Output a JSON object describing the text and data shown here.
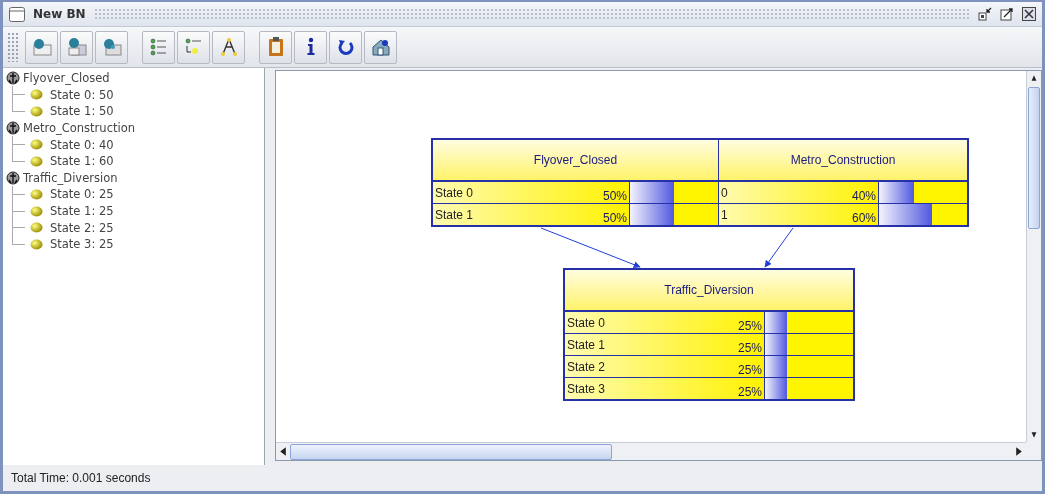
{
  "window": {
    "title": "New BN"
  },
  "tree": [
    {
      "name": "Flyover_Closed",
      "children": [
        {
          "label": "State 0: 50"
        },
        {
          "label": "State 1: 50"
        }
      ]
    },
    {
      "name": "Metro_Construction",
      "children": [
        {
          "label": "State 0: 40"
        },
        {
          "label": "State 1: 60"
        }
      ]
    },
    {
      "name": "Traffic_Diversion",
      "children": [
        {
          "label": "State 0: 25"
        },
        {
          "label": "State 1: 25"
        },
        {
          "label": "State 2: 25"
        },
        {
          "label": "State 3: 25"
        }
      ]
    }
  ],
  "boxes": [
    {
      "variables": [
        {
          "name": "Flyover_Closed",
          "states": [
            {
              "label": "State 0",
              "percent": "50%",
              "level": 0.5
            },
            {
              "label": "State 1",
              "percent": "50%",
              "level": 0.5
            }
          ]
        },
        {
          "name": "Metro_Construction",
          "states": [
            {
              "label": "0",
              "percent": "40%",
              "level": 0.4
            },
            {
              "label": "1",
              "percent": "60%",
              "level": 0.6
            }
          ]
        }
      ]
    },
    {
      "variables": [
        {
          "name": "Traffic_Diversion",
          "states": [
            {
              "label": "State 0",
              "percent": "25%",
              "level": 0.25
            },
            {
              "label": "State 1",
              "percent": "25%",
              "level": 0.25
            },
            {
              "label": "State 2",
              "percent": "25%",
              "level": 0.25
            },
            {
              "label": "State 3",
              "percent": "25%",
              "level": 0.25
            }
          ]
        }
      ]
    }
  ],
  "status_bar": "Total Time: 0.001 seconds"
}
